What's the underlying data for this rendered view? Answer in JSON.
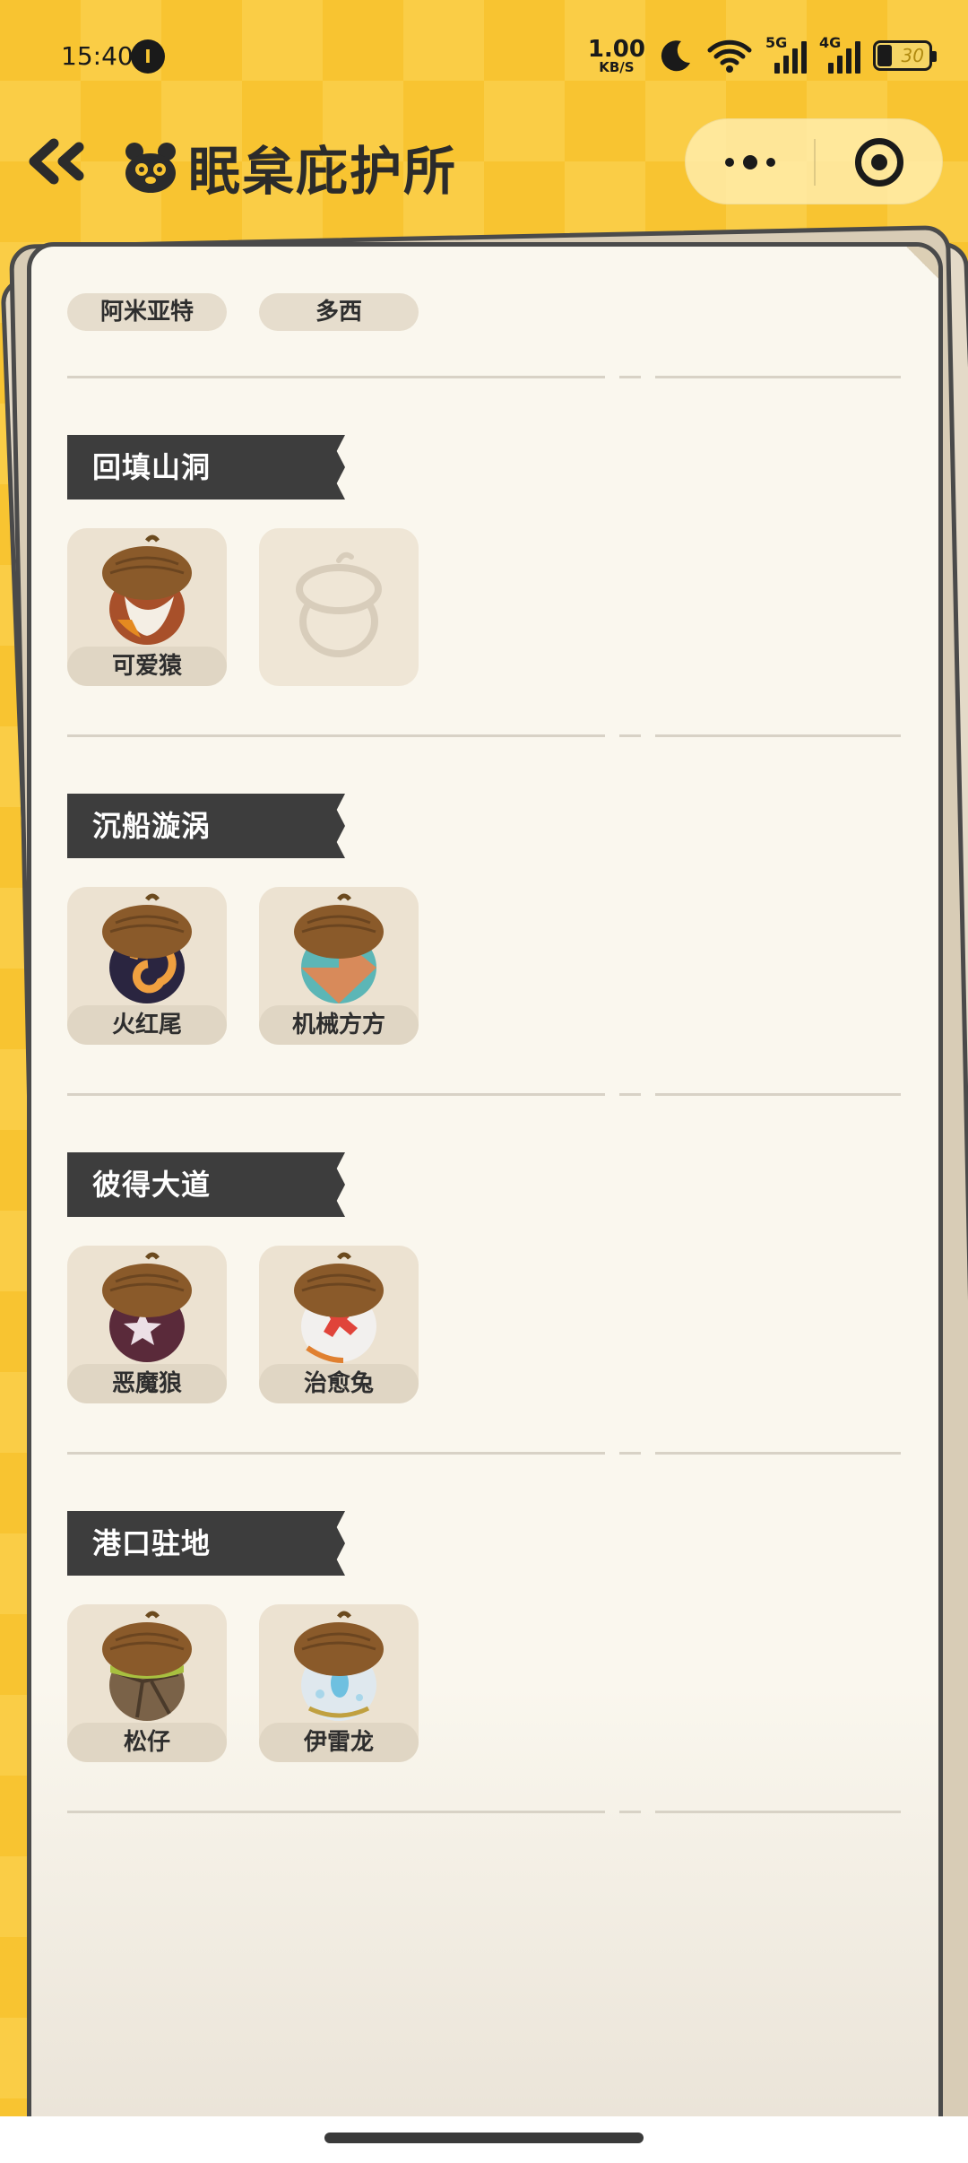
{
  "status_bar": {
    "time": "15:40",
    "notif_badge": "I",
    "net_speed_value": "1.00",
    "net_speed_unit": "KB/S",
    "sig1_label": "5G",
    "sig2_label": "4G",
    "battery": "30"
  },
  "header": {
    "title": "眠枲庇护所",
    "back_icon": "double-chevron-left-icon",
    "more_icon": "more-dots-icon",
    "close_icon": "target-circle-icon"
  },
  "top_chips": [
    "阿米亚特",
    "多西"
  ],
  "sections": [
    {
      "title": "回填山洞",
      "items": [
        {
          "name": "可爱猿",
          "acorn": "brown-red"
        },
        {
          "name": "",
          "acorn": "empty"
        }
      ]
    },
    {
      "title": "沉船漩涡",
      "items": [
        {
          "name": "火红尾",
          "acorn": "fire-swirl"
        },
        {
          "name": "机械方方",
          "acorn": "teal-checker"
        }
      ]
    },
    {
      "title": "彼得大道",
      "items": [
        {
          "name": "恶魔狼",
          "acorn": "dark-star"
        },
        {
          "name": "治愈兔",
          "acorn": "white-cross"
        }
      ]
    },
    {
      "title": "港口驻地",
      "items": [
        {
          "name": "松仔",
          "acorn": "olive-green"
        },
        {
          "name": "伊雷龙",
          "acorn": "blue-egg"
        }
      ]
    }
  ],
  "colors": {
    "background": "#f8c431",
    "paper": "#faf7ee",
    "section_title_bg": "#3d3d3d",
    "chip_bg": "#e6ddcd"
  }
}
